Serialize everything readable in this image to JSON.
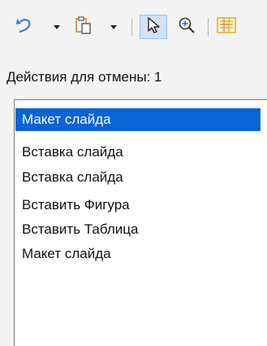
{
  "toolbar": {
    "icons": [
      "undo-icon",
      "paste-icon",
      "select-cursor-icon",
      "zoom-in-icon",
      "clip-art-icon"
    ],
    "colors": {
      "undo": "#3a7bd5",
      "paste": "#d98a2b",
      "selected_bg": "#cfe2f7"
    }
  },
  "undo_panel": {
    "label": "Действия для отмены: 1",
    "items": [
      {
        "label": "Макет слайда",
        "selected": true
      },
      {
        "label": "Вставка слайда",
        "selected": false
      },
      {
        "label": "Вставка слайда",
        "selected": false
      },
      {
        "label": "Вставить Фигура",
        "selected": false
      },
      {
        "label": "Вставить Таблица",
        "selected": false
      },
      {
        "label": "Макет слайда",
        "selected": false
      }
    ]
  }
}
